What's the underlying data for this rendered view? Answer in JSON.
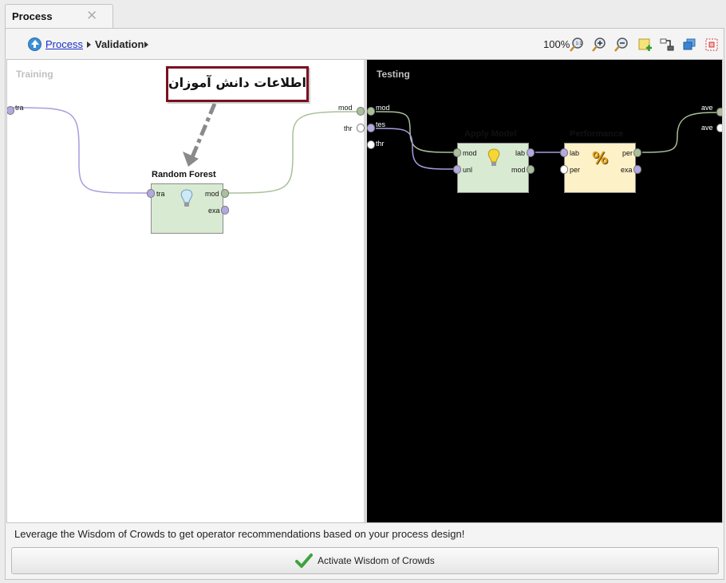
{
  "tab": {
    "title": "Process"
  },
  "breadcrumb": {
    "root": "Process",
    "current": "Validation"
  },
  "toolbar": {
    "zoom": "100%",
    "icons": [
      "zoom-reset-icon",
      "zoom-in-icon",
      "zoom-out-icon",
      "add-note-icon",
      "auto-wire-icon",
      "arrange-icon",
      "fit-icon"
    ]
  },
  "panes": {
    "training": "Training",
    "testing": "Testing"
  },
  "annotation": {
    "text": "اطلاعات دانش آموزان"
  },
  "training": {
    "left_ports": [
      "tra"
    ],
    "right_ports": [
      "mod",
      "thr"
    ]
  },
  "testing": {
    "left_ports": [
      "mod",
      "tes",
      "thr"
    ],
    "right_ports": [
      "ave",
      "ave"
    ]
  },
  "operators": {
    "random_forest": {
      "title": "Random Forest",
      "in": [
        "tra"
      ],
      "out": [
        "mod",
        "exa"
      ]
    },
    "apply_model": {
      "title": "Apply Model",
      "in": [
        "mod",
        "unl"
      ],
      "out": [
        "lab",
        "mod"
      ]
    },
    "performance": {
      "title": "Performance",
      "in": [
        "lab",
        "per"
      ],
      "out": [
        "per",
        "exa"
      ]
    }
  },
  "footer": {
    "hint": "Leverage the Wisdom of Crowds to get operator recommendations based on your process design!",
    "button": "Activate Wisdom of Crowds"
  },
  "colors": {
    "model_operator": "#d9ead3",
    "performance_operator": "#fdf1c8",
    "annotation_border": "#7a1020",
    "link": "#1a2fc9"
  }
}
